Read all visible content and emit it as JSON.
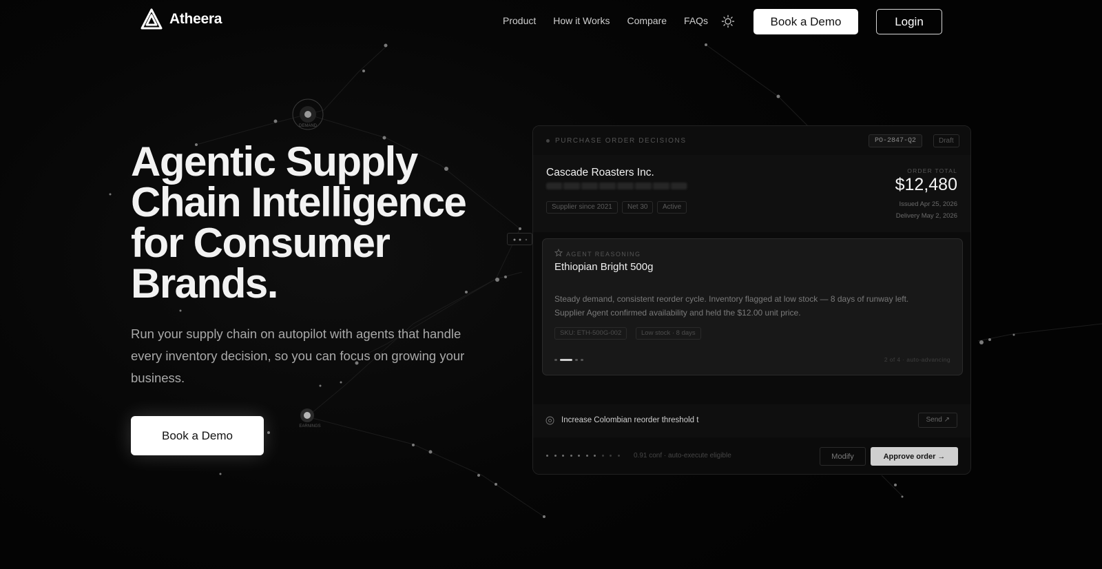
{
  "brand": {
    "name": "Atheera"
  },
  "nav": {
    "links": [
      "Product",
      "How it Works",
      "Compare",
      "FAQs"
    ],
    "theme_icon": "sun-icon",
    "cta": "Book a Demo",
    "login": "Login"
  },
  "hero": {
    "title_lines": [
      "Agentic Supply",
      "Chain Intelligence",
      "for Consumer",
      "Brands."
    ],
    "subtitle": "Run your supply chain on autopilot with agents that handle every inventory decision, so you can focus on growing your business.",
    "cta": "Book a Demo"
  },
  "background": {
    "node_labels": [
      "DEMAND",
      "EARNINGS"
    ]
  },
  "card": {
    "header_label": "PURCHASE ORDER DECISIONS",
    "po_number": "PO-2847-Q2",
    "status": "Draft",
    "supplier": {
      "name": "Cascade Roasters Inc.",
      "tags": [
        "Supplier since 2021",
        "Net 30",
        "Active"
      ]
    },
    "order": {
      "total_label": "ORDER TOTAL",
      "total": "$12,480",
      "issued": "Issued Apr 25, 2026",
      "delivery": "Delivery May 2, 2026"
    },
    "reasoning": {
      "label": "AGENT REASONING",
      "item": "Ethiopian Bright 500g",
      "text": "Steady demand, consistent reorder cycle. Inventory flagged at low stock — 8 days of runway left. Supplier Agent confirmed availability and held the $12.00 unit price.",
      "tags": [
        "SKU: ETH-500G-002",
        "Low stock · 8 days"
      ],
      "pager_total": 4,
      "pager_current": 2,
      "pager_text": "2 of 4 · auto-advancing"
    },
    "command": {
      "text": "Increase Colombian reorder threshold t",
      "send": "Send ↗"
    },
    "footer": {
      "confidence": 0.91,
      "confidence_text": "0.91 conf · auto-execute eligible",
      "modify": "Modify",
      "approve": "Approve order →"
    }
  }
}
